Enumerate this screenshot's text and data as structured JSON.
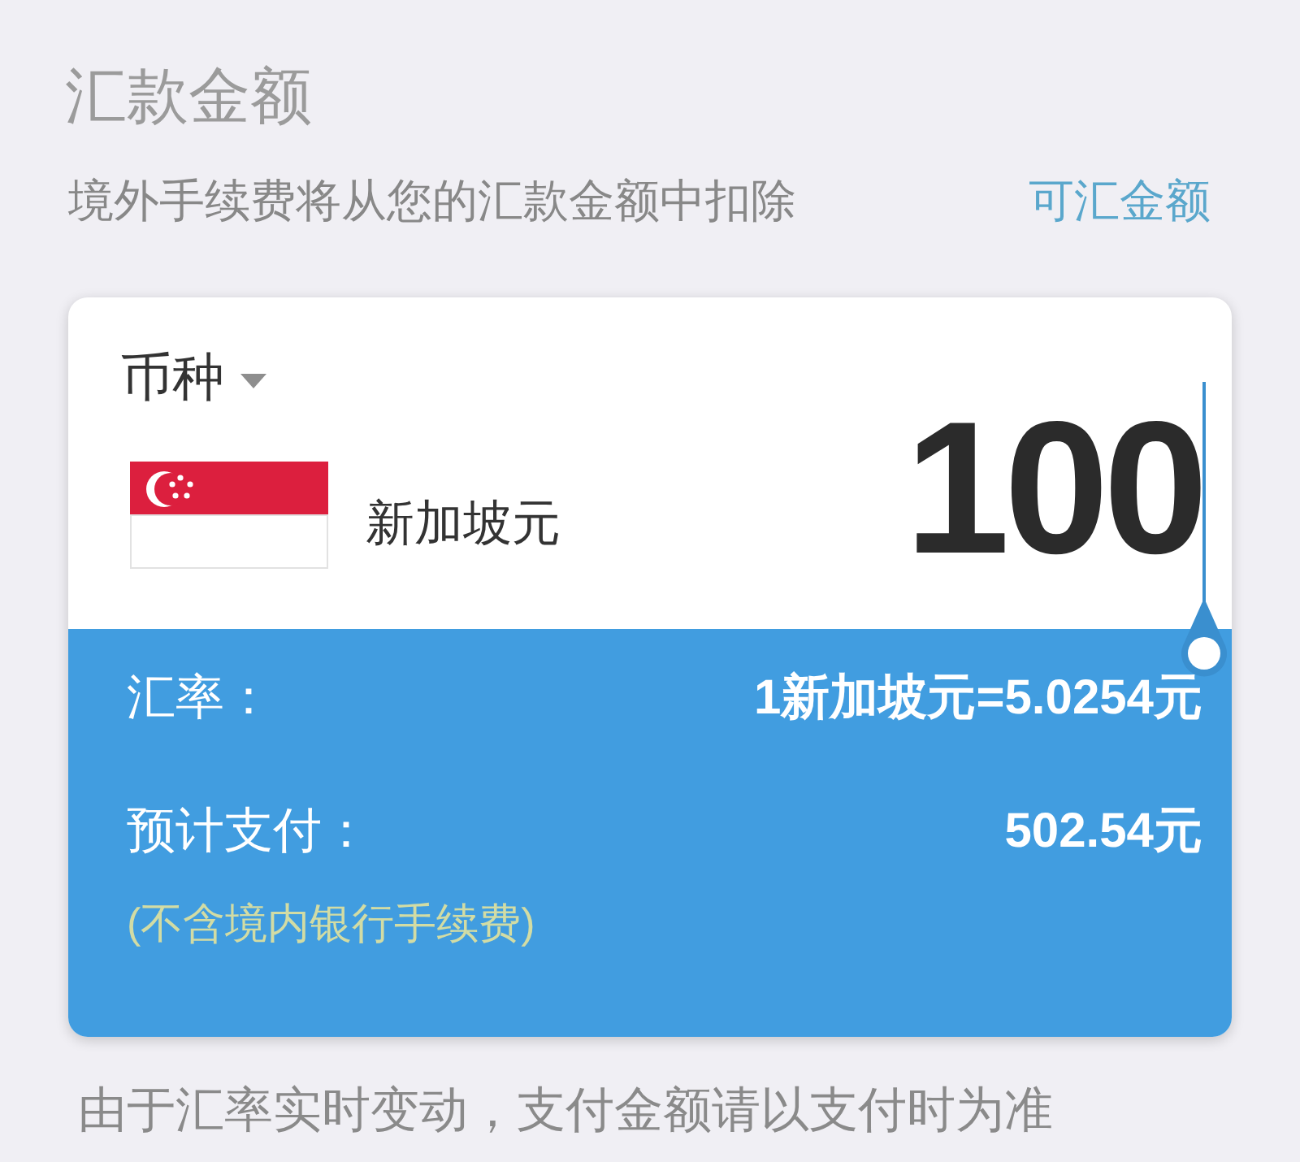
{
  "header": {
    "title": "汇款金额",
    "note": "境外手续费将从您的汇款金额中扣除",
    "link": "可汇金额"
  },
  "currency_card": {
    "label": "币种",
    "currency": "新加坡元",
    "amount": "100",
    "rate_label": "汇率：",
    "rate_value": "1新加坡元=5.0254元",
    "payment_label": "预计支付：",
    "payment_value": "502.54元",
    "payment_note": "(不含境内银行手续费)"
  },
  "footer": "由于汇率实时变动，支付金额请以支付时为准"
}
